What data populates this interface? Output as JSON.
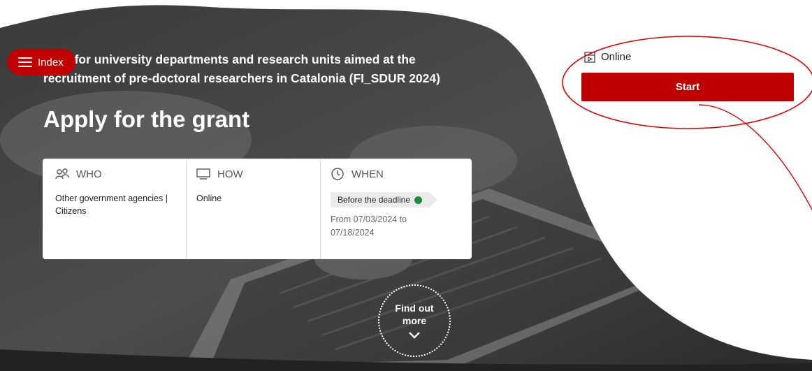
{
  "index_button": {
    "label": "Index"
  },
  "header": {
    "subtitle": "s for university departments and research units aimed at the recruitment of pre-doctoral researchers in Catalonia (FI_SDUR 2024)",
    "title": "Apply for the grant"
  },
  "info_card": {
    "who": {
      "heading": "WHO",
      "icon": "people-icon",
      "text": "Other government agencies | Citizens"
    },
    "how": {
      "heading": "HOW",
      "icon": "monitor-icon",
      "text": "Online"
    },
    "when": {
      "heading": "WHEN",
      "icon": "clock-icon",
      "status": "Before the deadline",
      "status_color": "#1e8c3a",
      "range_line1": "From 07/03/2024 to",
      "range_line2": "07/18/2024"
    }
  },
  "find_more": {
    "line1": "Find out",
    "line2": "more",
    "icon": "chevron-down-icon"
  },
  "sidebar": {
    "channel_label": "Online",
    "channel_icon": "online-form-icon",
    "start_label": "Start"
  },
  "colors": {
    "accent": "#c00000",
    "annotation": "#e00000"
  }
}
